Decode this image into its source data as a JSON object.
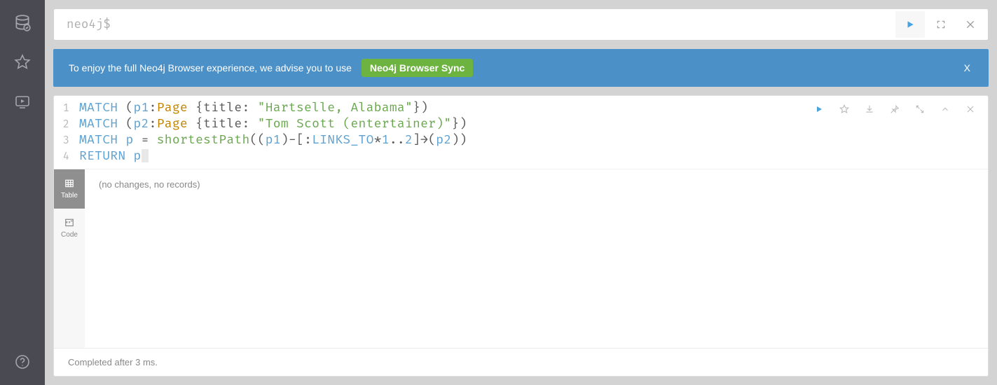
{
  "editor": {
    "prompt": "neo4j$"
  },
  "banner": {
    "text": "To enjoy the full Neo4j Browser experience, we advise you to use",
    "button": "Neo4j Browser Sync",
    "close": "X"
  },
  "sidebar": {
    "icons": [
      "database",
      "favorites",
      "guides",
      "help"
    ]
  },
  "query": {
    "lines": [
      {
        "n": "1",
        "tokens": [
          {
            "t": "MATCH",
            "c": "kw"
          },
          {
            "t": " (",
            "c": "punct"
          },
          {
            "t": "p1",
            "c": "var"
          },
          {
            "t": ":",
            "c": "punct"
          },
          {
            "t": "Page",
            "c": "lbl"
          },
          {
            "t": " {",
            "c": "punct"
          },
          {
            "t": "title",
            "c": "prop"
          },
          {
            "t": ": ",
            "c": "punct"
          },
          {
            "t": "\"Hartselle, Alabama\"",
            "c": "str"
          },
          {
            "t": "})",
            "c": "punct"
          }
        ]
      },
      {
        "n": "2",
        "tokens": [
          {
            "t": "MATCH",
            "c": "kw"
          },
          {
            "t": " (",
            "c": "punct"
          },
          {
            "t": "p2",
            "c": "var"
          },
          {
            "t": ":",
            "c": "punct"
          },
          {
            "t": "Page",
            "c": "lbl"
          },
          {
            "t": " {",
            "c": "punct"
          },
          {
            "t": "title",
            "c": "prop"
          },
          {
            "t": ": ",
            "c": "punct"
          },
          {
            "t": "\"Tom Scott (entertainer)\"",
            "c": "str"
          },
          {
            "t": "})",
            "c": "punct"
          }
        ]
      },
      {
        "n": "3",
        "tokens": [
          {
            "t": "MATCH",
            "c": "kw"
          },
          {
            "t": " ",
            "c": "punct"
          },
          {
            "t": "p",
            "c": "var"
          },
          {
            "t": " = ",
            "c": "punct"
          },
          {
            "t": "shortestPath",
            "c": "fn"
          },
          {
            "t": "((",
            "c": "punct"
          },
          {
            "t": "p1",
            "c": "var"
          },
          {
            "t": ")-[:",
            "c": "punct"
          },
          {
            "t": "LINKS_TO",
            "c": "rel"
          },
          {
            "t": "*",
            "c": "punct"
          },
          {
            "t": "1",
            "c": "num"
          },
          {
            "t": "..",
            "c": "punct"
          },
          {
            "t": "2",
            "c": "num"
          },
          {
            "t": "]→(",
            "c": "punct"
          },
          {
            "t": "p2",
            "c": "var"
          },
          {
            "t": "))",
            "c": "punct"
          }
        ]
      },
      {
        "n": "4",
        "tokens": [
          {
            "t": "RETURN",
            "c": "kw"
          },
          {
            "t": " ",
            "c": "punct"
          },
          {
            "t": "p",
            "c": "var"
          }
        ],
        "cursor": true
      }
    ]
  },
  "result": {
    "message": "(no changes, no records)",
    "footer": "Completed after 3 ms."
  },
  "views": [
    {
      "id": "table",
      "label": "Table",
      "active": true
    },
    {
      "id": "code",
      "label": "Code",
      "active": false
    }
  ]
}
